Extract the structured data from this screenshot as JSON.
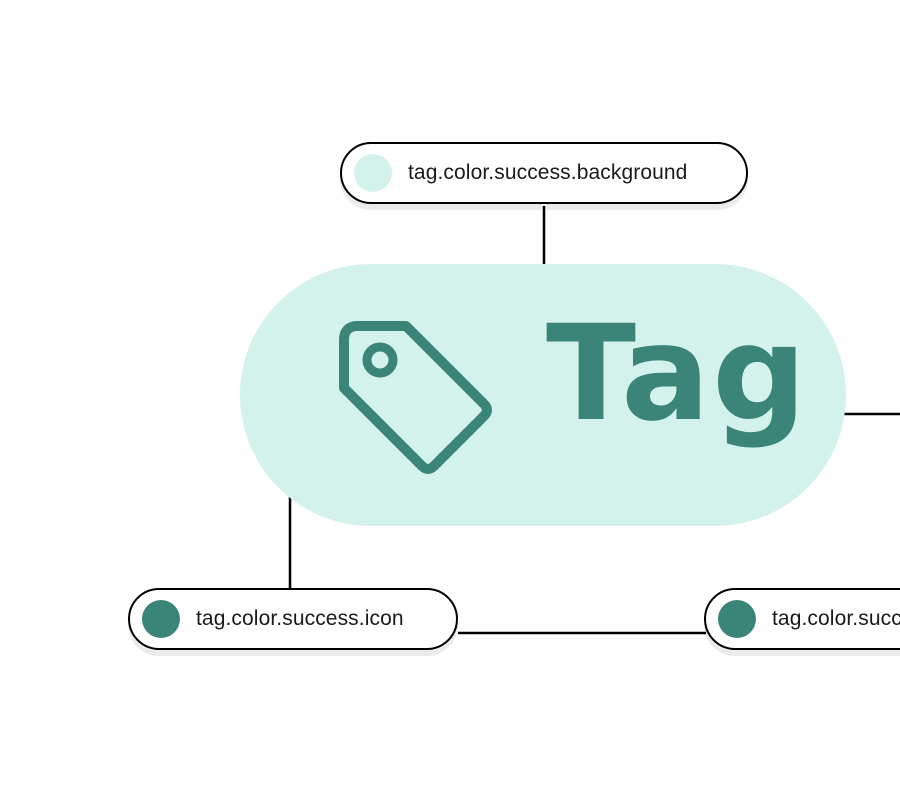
{
  "colors": {
    "success_background": "#d4f2ec",
    "success_icon": "#3a8478",
    "success_text": "#3a8478",
    "connector": "#000000"
  },
  "tokens": {
    "background": {
      "label": "tag.color.success.background",
      "swatch": "#d4f2ec"
    },
    "icon": {
      "label": "tag.color.success.icon",
      "swatch": "#3a8478"
    },
    "text": {
      "label": "tag.color.success.text",
      "swatch": "#3a8478"
    }
  },
  "tag": {
    "label": "Tag",
    "icon": "tag-icon"
  }
}
